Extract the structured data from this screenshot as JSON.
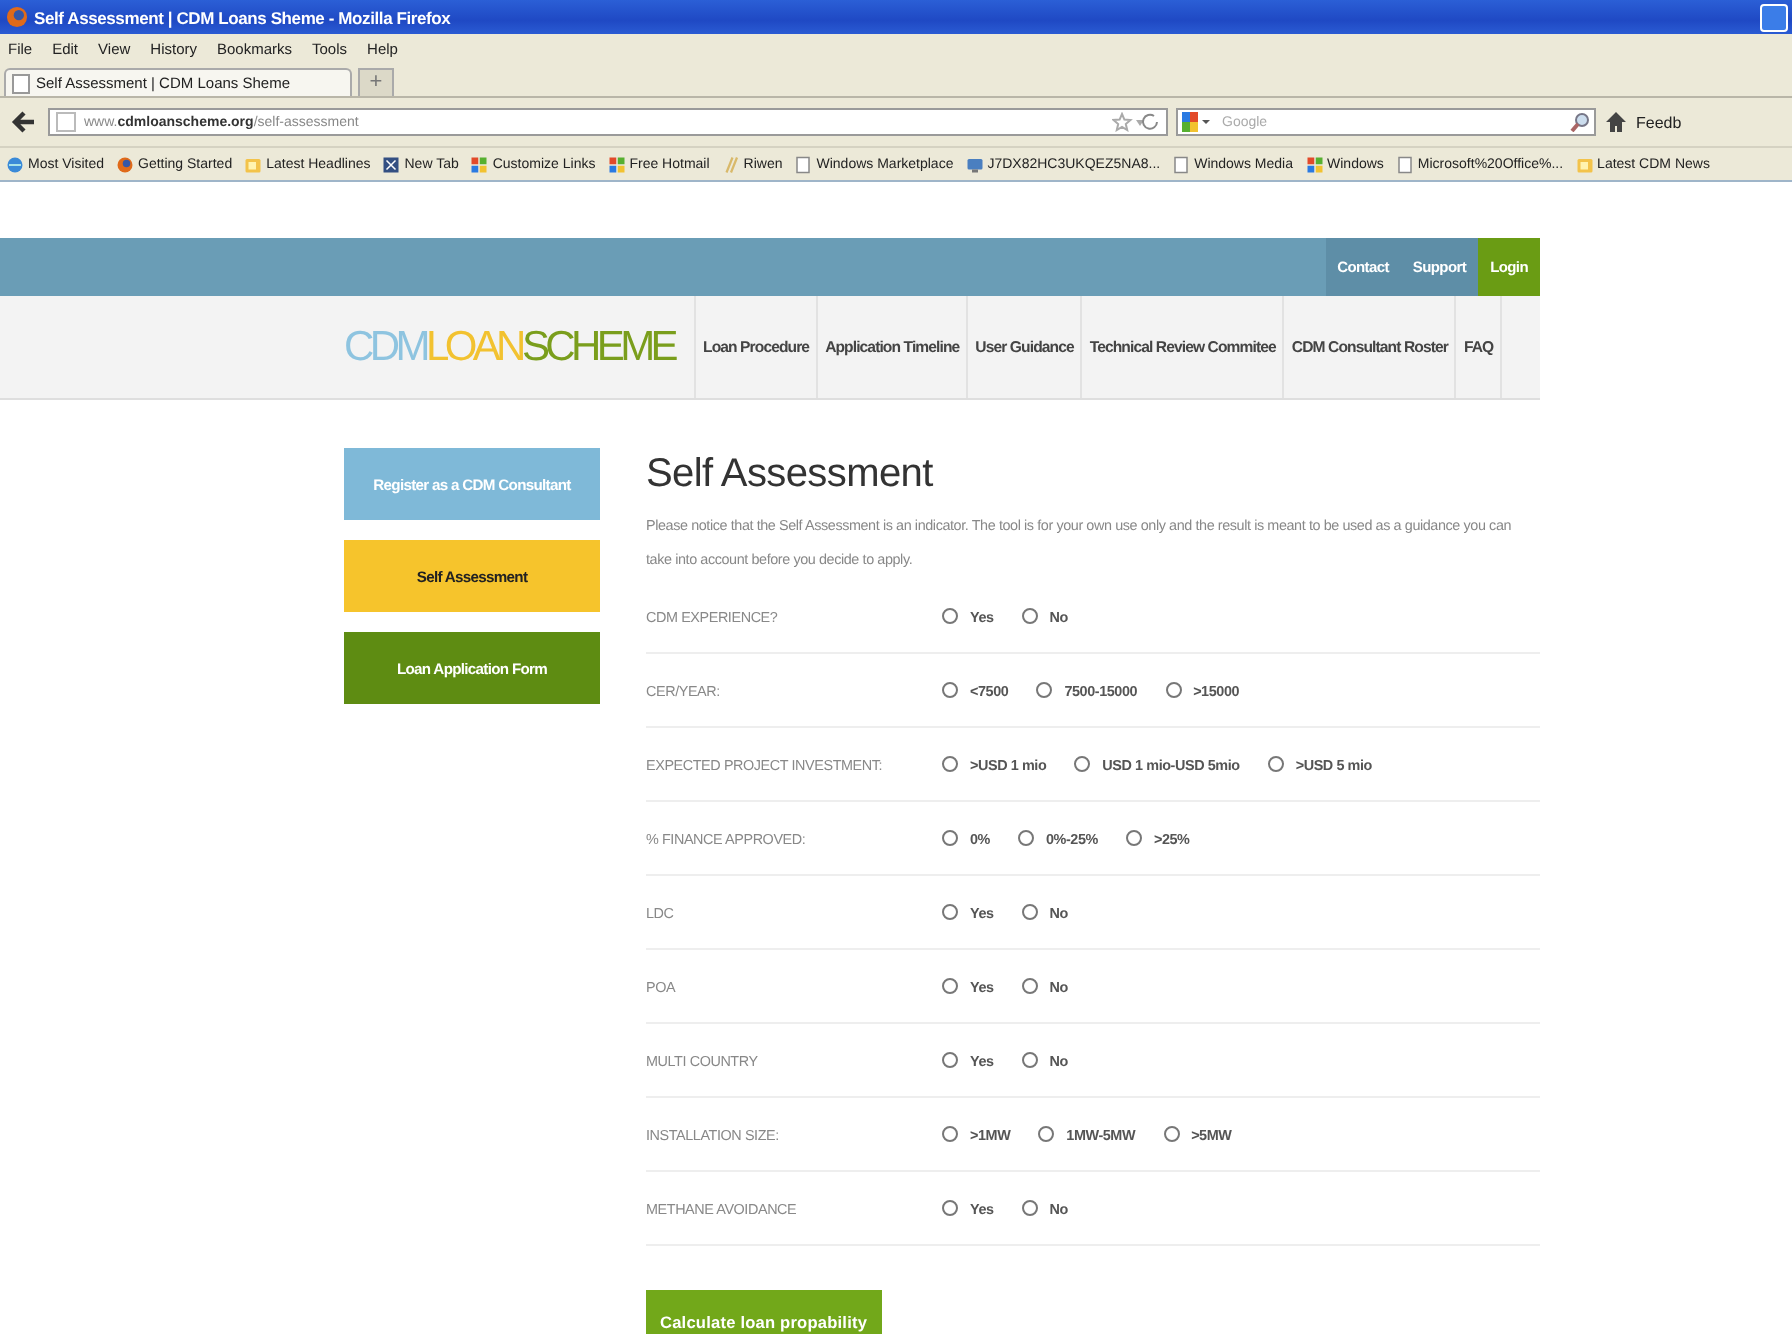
{
  "browser": {
    "title": "Self Assessment | CDM Loans Sheme - Mozilla Firefox",
    "menu": [
      "File",
      "Edit",
      "View",
      "History",
      "Bookmarks",
      "Tools",
      "Help"
    ],
    "tabs": [
      {
        "label": "Self Assessment | CDM Loans Sheme",
        "selected": true
      }
    ],
    "new_tab": "+",
    "url": "www.**cdmloanscheme.org**/self-assessment",
    "search": {
      "placeholder": "Google"
    },
    "toolbar_cut": "Feedb",
    "bookmarks": [
      {
        "label": "Most Visited",
        "kind": "globe"
      },
      {
        "label": "Getting Started",
        "kind": "firefox"
      },
      {
        "label": "Latest Headlines",
        "kind": "feed"
      },
      {
        "label": "New Tab",
        "kind": "tab"
      },
      {
        "label": "Customize Links",
        "kind": "windows"
      },
      {
        "label": "Free Hotmail",
        "kind": "windows"
      },
      {
        "label": "Riwen",
        "kind": "slash"
      },
      {
        "label": "Windows Marketplace",
        "kind": "page"
      },
      {
        "label": "J7DX82HC3UKQEZ5NA8...",
        "kind": "monitor"
      },
      {
        "label": "Windows Media",
        "kind": "page"
      },
      {
        "label": "Windows",
        "kind": "windows"
      },
      {
        "label": "Microsoft%20Office%...",
        "kind": "page"
      },
      {
        "label": "Latest CDM News",
        "kind": "feed"
      }
    ]
  },
  "site": {
    "top_links": [
      {
        "label": "Contact",
        "highlighted": false
      },
      {
        "label": "Support",
        "highlighted": false
      },
      {
        "label": "Login",
        "highlighted": true
      }
    ],
    "logo": [
      {
        "text": "CDM",
        "color": "#8ec4e0"
      },
      {
        "text": "LOAN",
        "color": "#f2c230"
      },
      {
        "text": "SCHEME",
        "color": "#7a9e1c"
      }
    ],
    "nav": [
      "Loan Procedure",
      "Application Timeline",
      "User Guidance",
      "Technical Review Commitee",
      "CDM Consultant Roster",
      "FAQ"
    ],
    "sidebar": [
      {
        "label": "Register as a CDM Consultant",
        "color": "#7fb9d8",
        "selected": false
      },
      {
        "label": "Self Assessment",
        "color": "#f6c42c",
        "selected": true
      },
      {
        "label": "Loan Application Form",
        "color": "#5e8c12",
        "selected": false
      }
    ],
    "heading": "Self Assessment",
    "intro": "Please notice that the Self Assessment is an indicator. The tool is for your own use only and the result is meant to be used as a guidance you can take into account before you decide to apply.",
    "questions": [
      {
        "label": "CDM EXPERIENCE?",
        "options": [
          {
            "label": "Yes",
            "selected": false
          },
          {
            "label": "No",
            "selected": false
          }
        ]
      },
      {
        "label": "CER/YEAR:",
        "options": [
          {
            "label": "<7500",
            "selected": false
          },
          {
            "label": "7500-15000",
            "selected": false
          },
          {
            "label": ">15000",
            "selected": false
          }
        ]
      },
      {
        "label": "EXPECTED PROJECT INVESTMENT:",
        "options": [
          {
            "label": ">USD 1 mio",
            "selected": false
          },
          {
            "label": "USD 1 mio-USD 5mio",
            "selected": false
          },
          {
            "label": ">USD 5 mio",
            "selected": false
          }
        ]
      },
      {
        "label": "% FINANCE APPROVED:",
        "options": [
          {
            "label": "0%",
            "selected": false
          },
          {
            "label": "0%-25%",
            "selected": false
          },
          {
            "label": ">25%",
            "selected": false
          }
        ]
      },
      {
        "label": "LDC",
        "options": [
          {
            "label": "Yes",
            "selected": false
          },
          {
            "label": "No",
            "selected": false
          }
        ]
      },
      {
        "label": "POA",
        "options": [
          {
            "label": "Yes",
            "selected": false
          },
          {
            "label": "No",
            "selected": false
          }
        ]
      },
      {
        "label": "MULTI COUNTRY",
        "options": [
          {
            "label": "Yes",
            "selected": false
          },
          {
            "label": "No",
            "selected": false
          }
        ]
      },
      {
        "label": "INSTALLATION SIZE:",
        "options": [
          {
            "label": ">1MW",
            "selected": false
          },
          {
            "label": "1MW-5MW",
            "selected": false
          },
          {
            "label": ">5MW",
            "selected": false
          }
        ]
      },
      {
        "label": "METHANE AVOIDANCE",
        "options": [
          {
            "label": "Yes",
            "selected": false
          },
          {
            "label": "No",
            "selected": false
          }
        ]
      }
    ],
    "submit": "Calculate loan propability"
  }
}
